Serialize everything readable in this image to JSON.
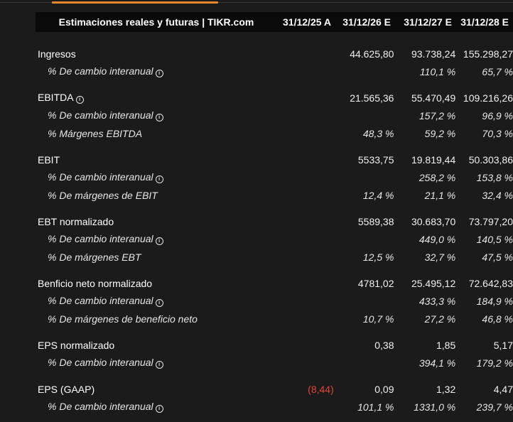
{
  "header": {
    "title": "Estimaciones reales y futuras | TIKR.com",
    "columns": [
      "31/12/25 A",
      "31/12/26 E",
      "31/12/27 E",
      "31/12/28 E"
    ]
  },
  "rows": {
    "ingresos": {
      "label": "Ingresos",
      "v": [
        "",
        "44.625,80",
        "93.738,24",
        "155.298,27"
      ]
    },
    "ingresos_yoy": {
      "label": "% De cambio interanual",
      "v": [
        "",
        "",
        "110,1 %",
        "65,7 %"
      ]
    },
    "ebitda": {
      "label": "EBITDA",
      "v": [
        "",
        "21.565,36",
        "55.470,49",
        "109.216,26"
      ]
    },
    "ebitda_yoy": {
      "label": "% De cambio interanual",
      "v": [
        "",
        "",
        "157,2 %",
        "96,9 %"
      ]
    },
    "ebitda_margin": {
      "label": "% Márgenes EBITDA",
      "v": [
        "",
        "48,3 %",
        "59,2 %",
        "70,3 %"
      ]
    },
    "ebit": {
      "label": "EBIT",
      "v": [
        "",
        "5533,75",
        "19.819,44",
        "50.303,86"
      ]
    },
    "ebit_yoy": {
      "label": "% De cambio interanual",
      "v": [
        "",
        "",
        "258,2 %",
        "153,8 %"
      ]
    },
    "ebit_margin": {
      "label": "% De márgenes de EBIT",
      "v": [
        "",
        "12,4 %",
        "21,1 %",
        "32,4 %"
      ]
    },
    "ebt": {
      "label": "EBT normalizado",
      "v": [
        "",
        "5589,38",
        "30.683,70",
        "73.797,20"
      ]
    },
    "ebt_yoy": {
      "label": "% De cambio interanual",
      "v": [
        "",
        "",
        "449,0 %",
        "140,5 %"
      ]
    },
    "ebt_margin": {
      "label": "% De márgenes EBT",
      "v": [
        "",
        "12,5 %",
        "32,7 %",
        "47,5 %"
      ]
    },
    "net": {
      "label": "Benficio neto normalizado",
      "v": [
        "",
        "4781,02",
        "25.495,12",
        "72.642,83"
      ]
    },
    "net_yoy": {
      "label": "% De cambio interanual",
      "v": [
        "",
        "",
        "433,3 %",
        "184,9 %"
      ]
    },
    "net_margin": {
      "label": "% De márgenes de beneficio neto",
      "v": [
        "",
        "10,7 %",
        "27,2 %",
        "46,8 %"
      ]
    },
    "eps": {
      "label": "EPS normalizado",
      "v": [
        "",
        "0,38",
        "1,85",
        "5,17"
      ]
    },
    "eps_yoy": {
      "label": "% De cambio interanual",
      "v": [
        "",
        "",
        "394,1 %",
        "179,2 %"
      ]
    },
    "eps_gaap": {
      "label": "EPS (GAAP)",
      "v": [
        "(8,44)",
        "0,09",
        "1,32",
        "4,47"
      ]
    },
    "eps_gaap_yoy": {
      "label": "% De cambio interanual",
      "v": [
        "",
        "101,1 %",
        "1331,0 %",
        "239,7 %"
      ]
    }
  },
  "colors": {
    "accent": "#e8862b",
    "negative": "#e0453a",
    "background": "#1b1b1b",
    "header_bg": "#0a0a0a"
  },
  "icons": {
    "info": "info-circle-icon"
  },
  "info_glyph": "i"
}
